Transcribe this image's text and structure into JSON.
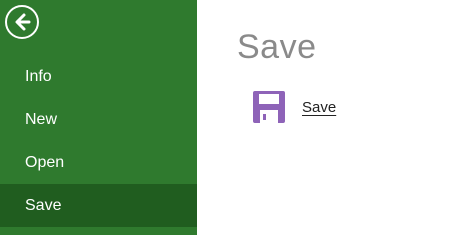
{
  "sidebar": {
    "back_icon": "back-arrow-circle-icon",
    "items": [
      {
        "label": "Info"
      },
      {
        "label": "New"
      },
      {
        "label": "Open"
      },
      {
        "label": "Save"
      }
    ],
    "active_item": "Save",
    "colors": {
      "background": "#2f7a2e",
      "active_background": "#205d1f",
      "text": "#ffffff"
    }
  },
  "main": {
    "title": "Save",
    "action": {
      "icon": "floppy-disk-icon",
      "label": "Save",
      "accent_color": "#8e63b8"
    }
  }
}
